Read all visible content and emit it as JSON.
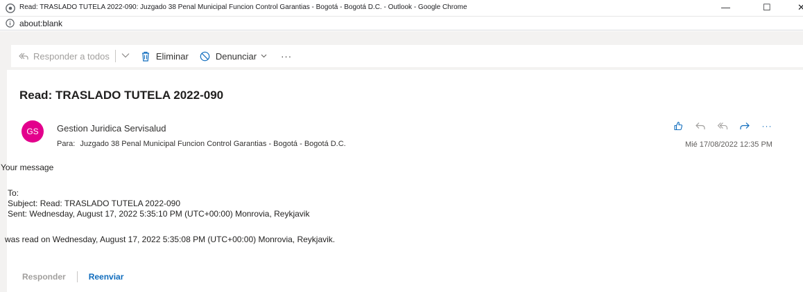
{
  "window": {
    "title": "Read: TRASLADO TUTELA 2022-090: Juzgado 38 Penal Municipal Funcion Control Garantias - Bogotá - Bogotá D.C. - Outlook - Google Chrome",
    "minimize": "—",
    "maximize": "☐",
    "close": "✕"
  },
  "address": {
    "url": "about:blank"
  },
  "toolbar": {
    "reply_all": "Responder a todos",
    "delete": "Eliminar",
    "report": "Denunciar",
    "more": "···"
  },
  "message": {
    "subject": "Read: TRASLADO TUTELA 2022-090",
    "avatar_initials": "GS",
    "avatar_color": "#e3008c",
    "sender": "Gestion Juridica Servisalud",
    "to_label": "Para:",
    "to": "Juzgado 38 Penal Municipal Funcion Control Garantias - Bogotá - Bogotá D.C.",
    "date": "Mié 17/08/2022 12:35 PM",
    "body": {
      "intro": "Your message",
      "to_line": "To:",
      "subject_line": "Subject: Read: TRASLADO TUTELA 2022-090",
      "sent_line": "Sent: Wednesday, August 17, 2022 5:35:10 PM (UTC+00:00) Monrovia, Reykjavik",
      "read_line": "was read on Wednesday, August 17, 2022 5:35:08 PM (UTC+00:00) Monrovia, Reykjavik."
    },
    "more": "···"
  },
  "footer": {
    "reply": "Responder",
    "forward": "Reenviar"
  },
  "icons": [
    "chrome-icon",
    "info-icon",
    "reply-all-icon",
    "chevron-down-icon",
    "trash-icon",
    "block-icon",
    "like-icon",
    "reply-icon",
    "forward-icon",
    "more-icon"
  ],
  "colors": {
    "accent": "#0f6cbd",
    "toolbar_bg": "#f3f2f1"
  }
}
